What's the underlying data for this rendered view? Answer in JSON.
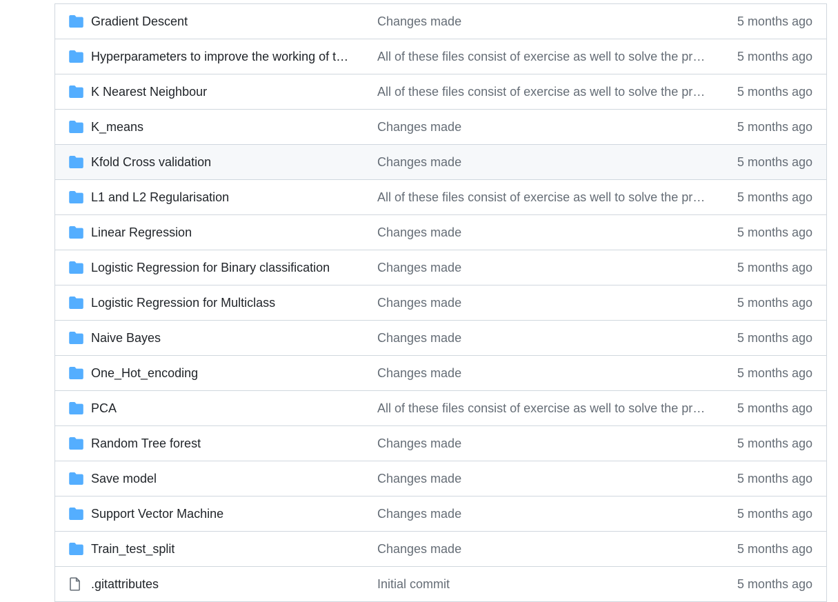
{
  "colors": {
    "folder_icon": "#54aeff",
    "name_text": "#1f2328",
    "muted_text": "#656d76",
    "border": "#d0d7de",
    "row_hover": "#f6f8fa"
  },
  "files": [
    {
      "type": "folder",
      "icon": "folder-icon",
      "name": "Gradient Descent",
      "message": "Changes made",
      "age": "5 months ago"
    },
    {
      "type": "folder",
      "icon": "folder-icon",
      "name": "Hyperparameters to improve the working of th...",
      "message": "All of these files consist of exercise as well to solve the probl...",
      "age": "5 months ago"
    },
    {
      "type": "folder",
      "icon": "folder-icon",
      "name": "K Nearest Neighbour",
      "message": "All of these files consist of exercise as well to solve the probl...",
      "age": "5 months ago"
    },
    {
      "type": "folder",
      "icon": "folder-icon",
      "name": "K_means",
      "message": "Changes made",
      "age": "5 months ago"
    },
    {
      "type": "folder",
      "icon": "folder-icon",
      "name": "Kfold Cross validation",
      "message": "Changes made",
      "age": "5 months ago",
      "hovered": true
    },
    {
      "type": "folder",
      "icon": "folder-icon",
      "name": "L1 and L2 Regularisation",
      "message": "All of these files consist of exercise as well to solve the probl...",
      "age": "5 months ago"
    },
    {
      "type": "folder",
      "icon": "folder-icon",
      "name": "Linear Regression",
      "message": "Changes made",
      "age": "5 months ago"
    },
    {
      "type": "folder",
      "icon": "folder-icon",
      "name": "Logistic Regression for Binary classification",
      "message": "Changes made",
      "age": "5 months ago"
    },
    {
      "type": "folder",
      "icon": "folder-icon",
      "name": "Logistic Regression for Multiclass",
      "message": "Changes made",
      "age": "5 months ago"
    },
    {
      "type": "folder",
      "icon": "folder-icon",
      "name": "Naive Bayes",
      "message": "Changes made",
      "age": "5 months ago"
    },
    {
      "type": "folder",
      "icon": "folder-icon",
      "name": "One_Hot_encoding",
      "message": "Changes made",
      "age": "5 months ago"
    },
    {
      "type": "folder",
      "icon": "folder-icon",
      "name": "PCA",
      "message": "All of these files consist of exercise as well to solve the probl...",
      "age": "5 months ago"
    },
    {
      "type": "folder",
      "icon": "folder-icon",
      "name": "Random Tree forest",
      "message": "Changes made",
      "age": "5 months ago"
    },
    {
      "type": "folder",
      "icon": "folder-icon",
      "name": "Save model",
      "message": "Changes made",
      "age": "5 months ago"
    },
    {
      "type": "folder",
      "icon": "folder-icon",
      "name": "Support Vector Machine",
      "message": "Changes made",
      "age": "5 months ago"
    },
    {
      "type": "folder",
      "icon": "folder-icon",
      "name": "Train_test_split",
      "message": "Changes made",
      "age": "5 months ago"
    },
    {
      "type": "file",
      "icon": "file-icon",
      "name": ".gitattributes",
      "message": "Initial commit",
      "age": "5 months ago"
    }
  ]
}
